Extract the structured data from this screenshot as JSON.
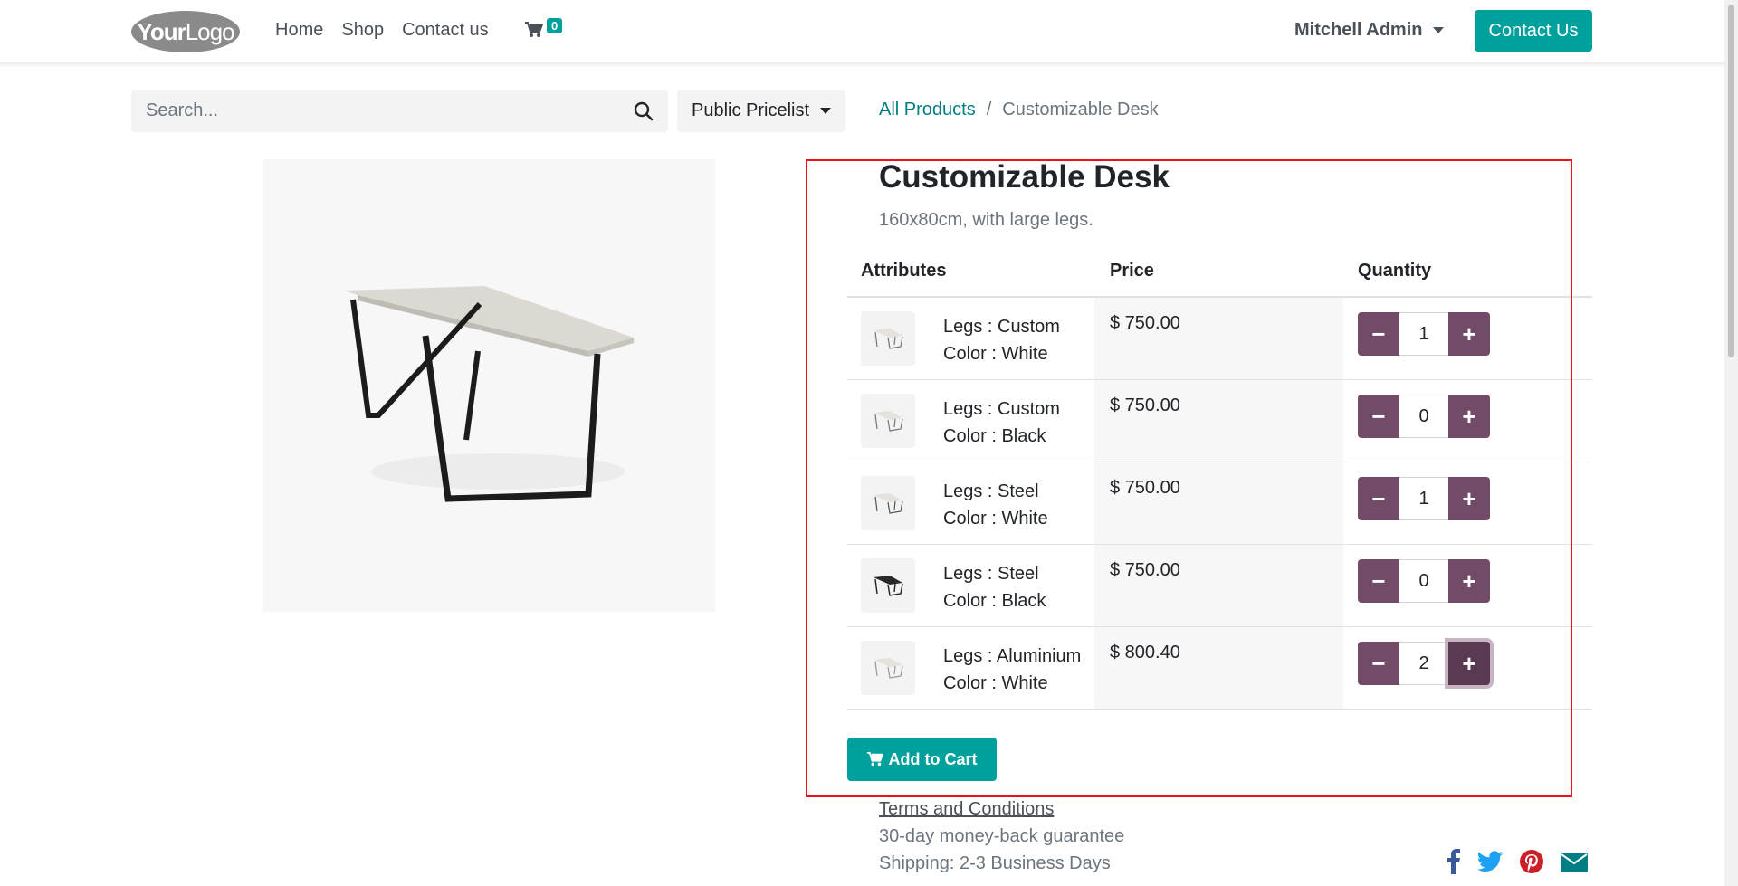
{
  "header": {
    "logo_text_bold": "Your",
    "logo_text": "Logo",
    "nav": [
      "Home",
      "Shop",
      "Contact us"
    ],
    "cart_count": "0",
    "user_name": "Mitchell Admin",
    "contact_button": "Contact Us"
  },
  "search": {
    "placeholder": "Search...",
    "pricelist": "Public Pricelist"
  },
  "breadcrumb": {
    "link": "All Products",
    "separator": "/",
    "current": "Customizable Desk"
  },
  "product": {
    "title": "Customizable Desk",
    "subtitle": "160x80cm, with large legs."
  },
  "table": {
    "headers": {
      "attributes": "Attributes",
      "price": "Price",
      "quantity": "Quantity"
    },
    "rows": [
      {
        "legs": "Legs : Custom",
        "color": "Color : White",
        "price": "$ 750.00",
        "qty": "1"
      },
      {
        "legs": "Legs : Custom",
        "color": "Color : Black",
        "price": "$ 750.00",
        "qty": "0"
      },
      {
        "legs": "Legs : Steel",
        "color": "Color : White",
        "price": "$ 750.00",
        "qty": "1"
      },
      {
        "legs": "Legs : Steel",
        "color": "Color : Black",
        "price": "$ 750.00",
        "qty": "0"
      },
      {
        "legs": "Legs : Aluminium",
        "color": "Color : White",
        "price": "$ 800.40",
        "qty": "2"
      }
    ]
  },
  "actions": {
    "add_to_cart": "Add to Cart"
  },
  "info": {
    "terms": "Terms and Conditions",
    "guarantee": "30-day money-back guarantee",
    "shipping": "Shipping: 2-3 Business Days"
  },
  "colors": {
    "primary": "#00a09d",
    "secondary": "#714b67",
    "link": "#017e84"
  },
  "icons": {
    "cart": "shopping-cart-icon",
    "search": "search-icon",
    "minus": "minus-icon",
    "plus": "plus-icon",
    "social": [
      "facebook-icon",
      "twitter-icon",
      "pinterest-icon",
      "email-icon"
    ]
  }
}
